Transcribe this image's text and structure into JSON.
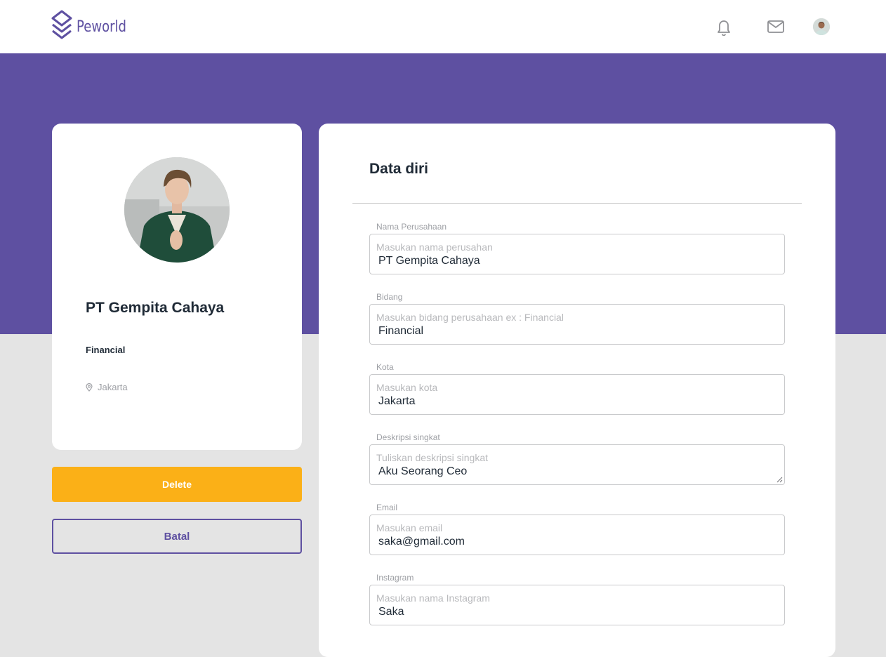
{
  "brand": {
    "name": "Peworld",
    "color": "#5e50a1"
  },
  "nav": {
    "icons": [
      "bell-icon",
      "mail-icon"
    ],
    "user_avatar": "user-avatar"
  },
  "profile": {
    "company_name": "PT Gempita Cahaya",
    "field": "Financial",
    "city": "Jakarta"
  },
  "actions": {
    "delete_label": "Delete",
    "cancel_label": "Batal"
  },
  "form": {
    "title": "Data diri",
    "fields": [
      {
        "label": "Nama Perusahaan",
        "placeholder": "Masukan nama perusahan",
        "value": "PT Gempita Cahaya"
      },
      {
        "label": "Bidang",
        "placeholder": "Masukan bidang perusahaan ex : Financial",
        "value": "Financial"
      },
      {
        "label": "Kota",
        "placeholder": "Masukan kota",
        "value": "Jakarta"
      },
      {
        "label": "Deskripsi singkat",
        "placeholder": "Tuliskan deskripsi singkat",
        "value": "Aku Seorang Ceo"
      },
      {
        "label": "Email",
        "placeholder": "Masukan email",
        "value": "saka@gmail.com"
      },
      {
        "label": "Instagram",
        "placeholder": "Masukan nama Instagram",
        "value": "Saka"
      }
    ]
  },
  "colors": {
    "primary": "#5e50a1",
    "accent": "#fbb017",
    "background": "#e4e4e4"
  }
}
